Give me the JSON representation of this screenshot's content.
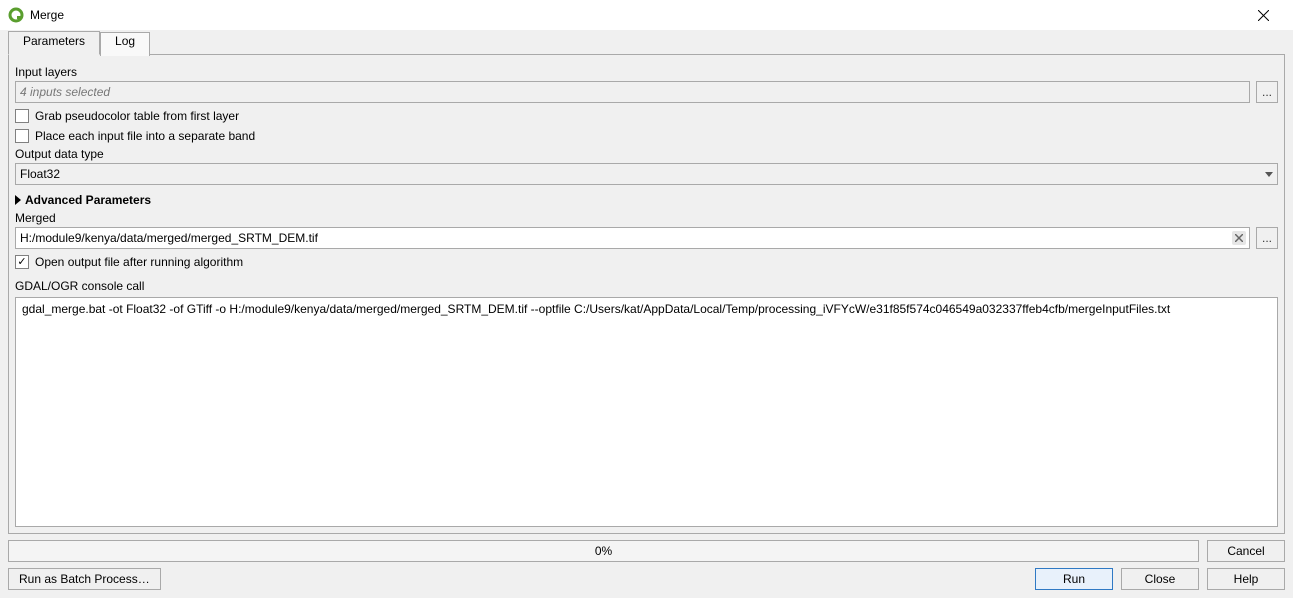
{
  "window": {
    "title": "Merge"
  },
  "tabs": {
    "parameters": "Parameters",
    "log": "Log"
  },
  "labels": {
    "input_layers": "Input layers",
    "output_data_type": "Output data type",
    "advanced_parameters": "Advanced Parameters",
    "merged": "Merged",
    "console_call": "GDAL/OGR console call"
  },
  "values": {
    "input_layers_summary": "4 inputs selected",
    "output_data_type": "Float32",
    "merged_path": "H:/module9/kenya/data/merged/merged_SRTM_DEM.tif",
    "console_call": "gdal_merge.bat -ot Float32 -of GTiff -o H:/module9/kenya/data/merged/merged_SRTM_DEM.tif --optfile C:/Users/kat/AppData/Local/Temp/processing_iVFYcW/e31f85f574c046549a032337ffeb4cfb/mergeInputFiles.txt",
    "progress_text": "0%"
  },
  "checkboxes": {
    "grab_pseudocolor": {
      "label": "Grab pseudocolor table from first layer",
      "checked": false
    },
    "separate_band": {
      "label": "Place each input file into a separate band",
      "checked": false
    },
    "open_output": {
      "label": "Open output file after running algorithm",
      "checked": true
    }
  },
  "buttons": {
    "browse": "...",
    "cancel": "Cancel",
    "run_batch": "Run as Batch Process…",
    "run": "Run",
    "close": "Close",
    "help": "Help"
  }
}
